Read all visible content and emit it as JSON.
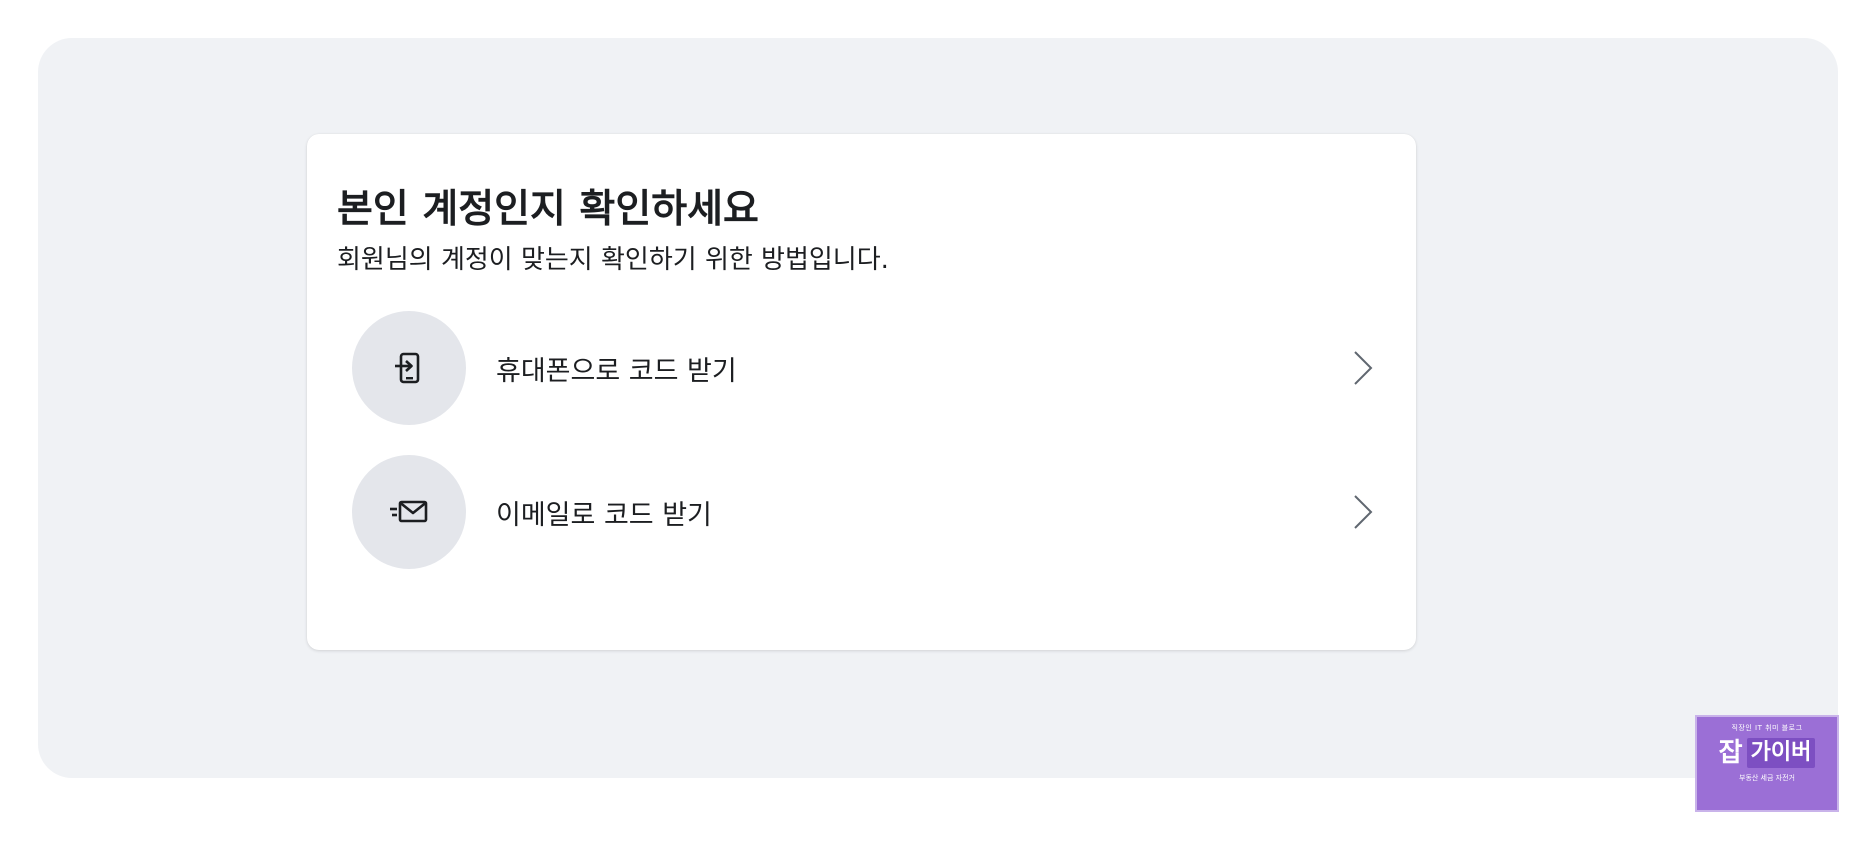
{
  "dialog": {
    "title": "본인 계정인지 확인하세요",
    "subtitle": "회원님의 계정이 맞는지 확인하기 위한 방법입니다."
  },
  "options": [
    {
      "label": "휴대폰으로 코드 받기",
      "icon": "phone-login-icon"
    },
    {
      "label": "이메일로 코드 받기",
      "icon": "email-send-icon"
    }
  ],
  "badge": {
    "top": "직장인 IT 취미 블로그",
    "big1": "잡",
    "big2": "가이버",
    "bottom": "부동산 세금 자전거"
  },
  "colors": {
    "panel_bg": "#f0f2f5",
    "card_bg": "#ffffff",
    "icon_circle_bg": "#e4e6eb",
    "text": "#1c1e21",
    "badge_bg": "#9b6fd6"
  }
}
